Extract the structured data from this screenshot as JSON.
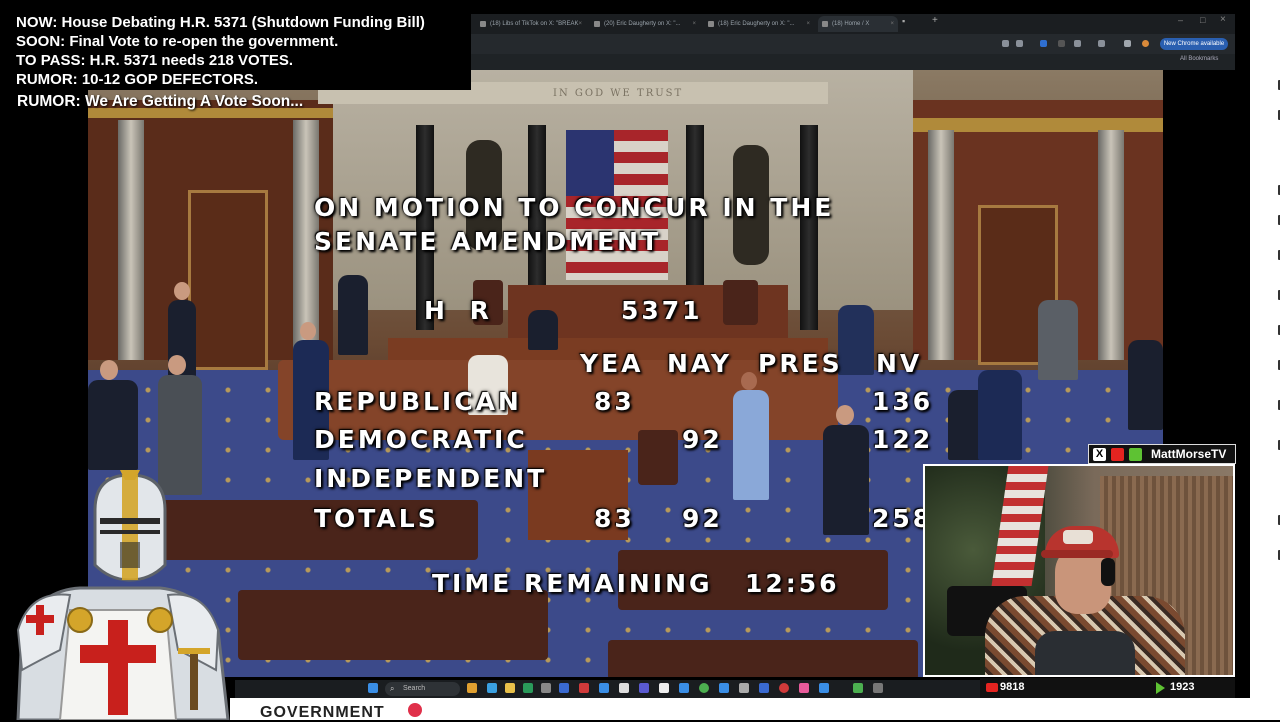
{
  "ticker": {
    "now": "NOW: House Debating H.R. 5371 (Shutdown Funding Bill)",
    "soon": "SOON: Final Vote to re-open the government.",
    "to_pass": "TO PASS: H.R. 5371 needs 218 VOTES.",
    "rumor1": "RUMOR: 10-12 GOP DEFECTORS.",
    "rumor2": "RUMOR: We Are Getting A Vote Soon..."
  },
  "browser": {
    "tabs": [
      {
        "label": "(18) Libs of TikTok on X: \"BREAK"
      },
      {
        "label": "(20) Eric Daugherty on X: \"..."
      },
      {
        "label": "(18) Eric Daugherty on X: \"..."
      },
      {
        "label": "(18) Home / X"
      }
    ],
    "update_label": "New Chrome available",
    "bookmarks_label": "All Bookmarks"
  },
  "vote_board": {
    "motion_line1": "ON MOTION TO CONCUR IN THE",
    "motion_line2": "SENATE AMENDMENT",
    "bill_prefix": "H R",
    "bill_number": "5371",
    "headers": {
      "yea": "YEA",
      "nay": "NAY",
      "pres": "PRES",
      "nv": "NV"
    },
    "rows": [
      {
        "party": "REPUBLICAN",
        "yea": "83",
        "nay": "",
        "pres": "",
        "nv": "136"
      },
      {
        "party": "DEMOCRATIC",
        "yea": "",
        "nay": "92",
        "pres": "",
        "nv": "122"
      },
      {
        "party": "INDEPENDENT",
        "yea": "",
        "nay": "",
        "pres": "",
        "nv": ""
      },
      {
        "party": "TOTALS",
        "yea": "83",
        "nay": "92",
        "pres": "",
        "nv": "258"
      }
    ],
    "time_label": "TIME REMAINING",
    "time_value": "12:56",
    "motto": "IN GOD WE TRUST"
  },
  "stream": {
    "handle": "MattMorseTV",
    "youtube_viewers": "9818",
    "rumble_viewers": "1923"
  },
  "taskbar": {
    "search_label": "Search"
  },
  "footer": {
    "text": "GOVERNMENT"
  },
  "colors": {
    "youtube": "#e52420",
    "rumble": "#5ec233",
    "chrome_update": "#2a5fb0",
    "knight_cross": "#c8201c"
  }
}
